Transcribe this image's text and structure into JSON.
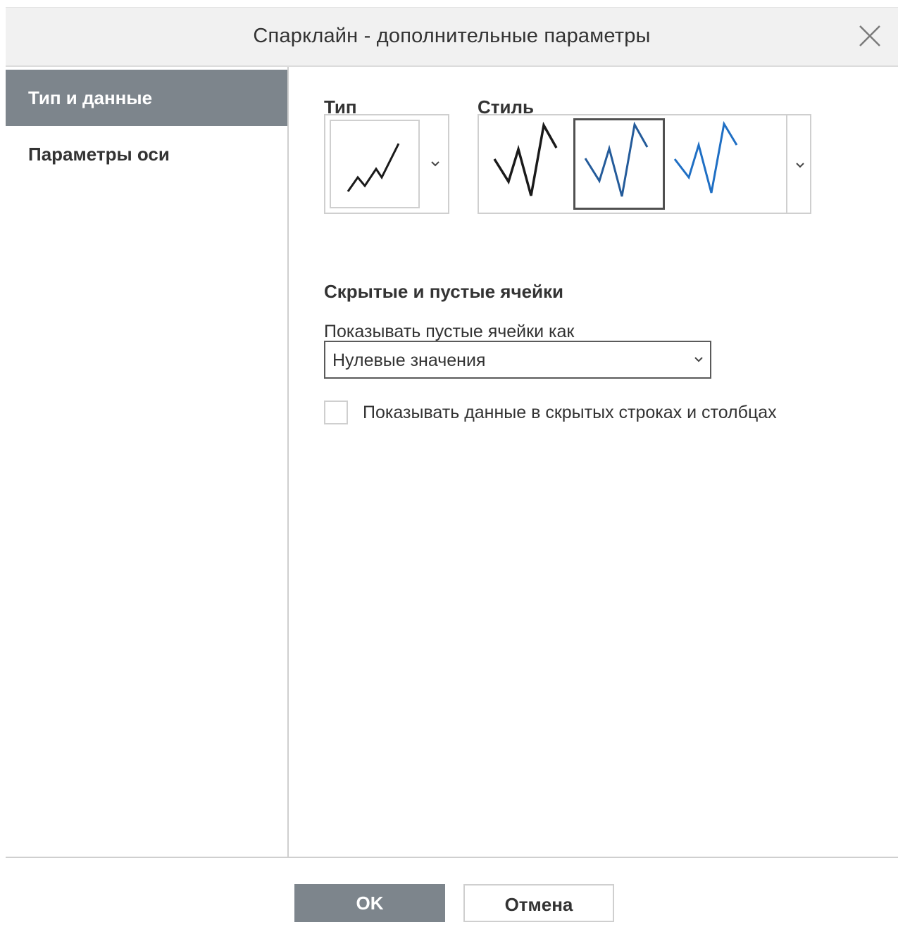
{
  "dialog": {
    "title": "Спарклайн - дополнительные параметры",
    "close_icon": "close-icon"
  },
  "sidebar": {
    "items": [
      {
        "label": "Тип и данные",
        "active": true
      },
      {
        "label": "Параметры оси",
        "active": false
      }
    ]
  },
  "type_section": {
    "label": "Тип",
    "selected_icon": "line-sparkline-icon"
  },
  "style_section": {
    "label": "Стиль",
    "styles": [
      {
        "icon": "style-black-icon",
        "color": "#1a1a1a",
        "selected": false
      },
      {
        "icon": "style-darkblue-icon",
        "color": "#245b9a",
        "selected": true
      },
      {
        "icon": "style-blue-icon",
        "color": "#1f6fc4",
        "selected": false
      }
    ]
  },
  "hidden_cells": {
    "title": "Скрытые и пустые ячейки",
    "empty_label": "Показывать пустые ячейки как",
    "empty_value": "Нулевые значения",
    "show_hidden_label": "Показывать данные в скрытых строках и столбцах",
    "show_hidden_checked": false
  },
  "footer": {
    "ok_label": "OK",
    "cancel_label": "Отмена"
  },
  "colors": {
    "accent": "#7d858c",
    "header_bg": "#f1f1f1",
    "border": "#cfcfcf"
  }
}
